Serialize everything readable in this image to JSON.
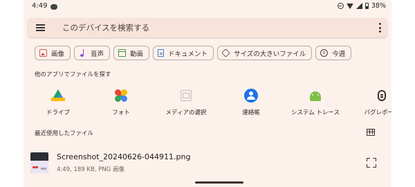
{
  "status_bar": {
    "time": "4:49",
    "battery": "38%"
  },
  "search": {
    "placeholder": "このデバイスを検索する"
  },
  "chips": [
    {
      "label": "画像",
      "icon": "image-icon",
      "color": "#d05a4a"
    },
    {
      "label": "音声",
      "icon": "audio-icon",
      "color": "#8a4fd0"
    },
    {
      "label": "動画",
      "icon": "video-icon",
      "color": "#3f9a4a"
    },
    {
      "label": "ドキュメント",
      "icon": "document-icon",
      "color": "#3b7fc6"
    },
    {
      "label": "サイズの大きいファイル",
      "icon": "tag-icon",
      "color": "#4a403b"
    },
    {
      "label": "今週",
      "icon": "history-icon",
      "color": "#4a403b"
    }
  ],
  "apps_section": {
    "title": "他のアプリでファイルを探す",
    "items": [
      {
        "label": "ドライブ",
        "icon": "google-drive-icon"
      },
      {
        "label": "フォト",
        "icon": "google-photos-icon"
      },
      {
        "label": "メディアの選択",
        "icon": "media-picker-icon"
      },
      {
        "label": "連絡帳",
        "icon": "contacts-icon"
      },
      {
        "label": "システム トレース",
        "icon": "system-trace-icon"
      },
      {
        "label": "バグレポート",
        "icon": "bug-report-icon"
      }
    ]
  },
  "recent_section": {
    "title": "最近使用したファイル",
    "files": [
      {
        "name": "Screenshot_20240626-044911.png",
        "meta": "4:49, 189 KB, PNG 画像"
      }
    ]
  },
  "colors": {
    "background": "#fdf1ec",
    "search_bar": "#f7e3da"
  }
}
